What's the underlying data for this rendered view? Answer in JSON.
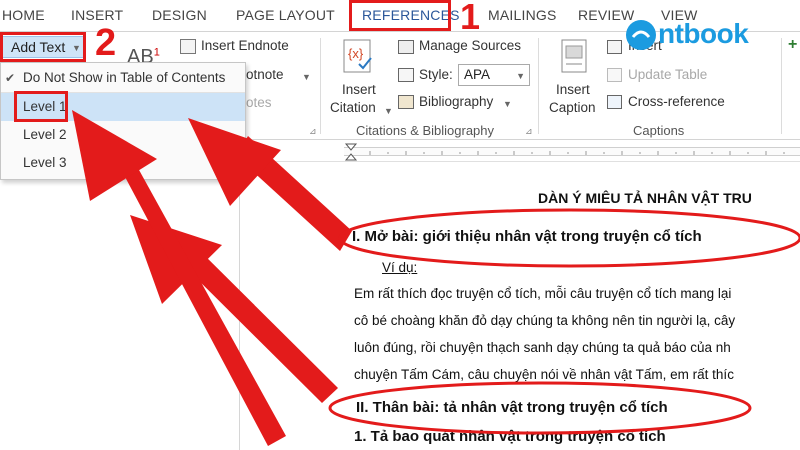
{
  "ribbon_tabs": {
    "home": "HOME",
    "insert": "INSERT",
    "design": "DESIGN",
    "page_layout": "PAGE LAYOUT",
    "references": "REFERENCES",
    "mailings": "MAILINGS",
    "review": "REVIEW",
    "view": "VIEW"
  },
  "annotations": {
    "step1": "1",
    "step2": "2"
  },
  "toc_group": {
    "add_text": "Add Text"
  },
  "footnotes_group": {
    "insert_endnote": "Insert Endnote",
    "next_footnote_partial": "otnote",
    "show_notes_partial": "otes"
  },
  "citations_group": {
    "insert_citation_line1": "Insert",
    "insert_citation_line2": "Citation",
    "manage_sources": "Manage Sources",
    "style_label": "Style:",
    "style_value": "APA",
    "bibliography": "Bibliography",
    "group_label": "Citations & Bibliography"
  },
  "captions_group": {
    "insert_caption_line1": "Insert",
    "insert_caption_line2": "Caption",
    "insert_table_of_figures_partial": "Insert",
    "update_table": "Update Table",
    "cross_reference": "Cross-reference",
    "group_label": "Captions"
  },
  "watermark": {
    "logo_text": "ntbook"
  },
  "add_text_menu": {
    "items": [
      "Do Not Show in Table of Contents",
      "Level 1",
      "Level 2",
      "Level 3"
    ],
    "checked_item": "Do Not Show in Table of Contents",
    "highlighted_item": "Level 1"
  },
  "document": {
    "title": "DÀN Ý MIÊU TẢ NHÂN VẬT TRU",
    "heading1": "I.  Mở bài: giới thiệu nhân vật trong truyện cổ tích",
    "example_label": "Ví dụ:",
    "body_lines": [
      "Em rất thích đọc truyện cổ tích, mỗi câu truyện cổ tích mang lại",
      "cô bé choàng khăn đỏ dạy chúng ta không nên tin người lạ, cây",
      "luôn đúng, rồi chuyện thạch sanh dạy chúng ta quả báo của nh",
      "chuyện Tấm Cám, câu chuyện nói về nhân vật Tấm, em rất thíc"
    ],
    "heading2": "II.  Thân bài: tả nhân vật trong truyện cổ tích",
    "subheading": "1. Tả bao quát nhân vật trong truyện cổ tích"
  },
  "colors": {
    "annotation_red": "#e31b1b",
    "menu_highlight": "#cde3f7",
    "logo_blue": "#1b9be0"
  }
}
